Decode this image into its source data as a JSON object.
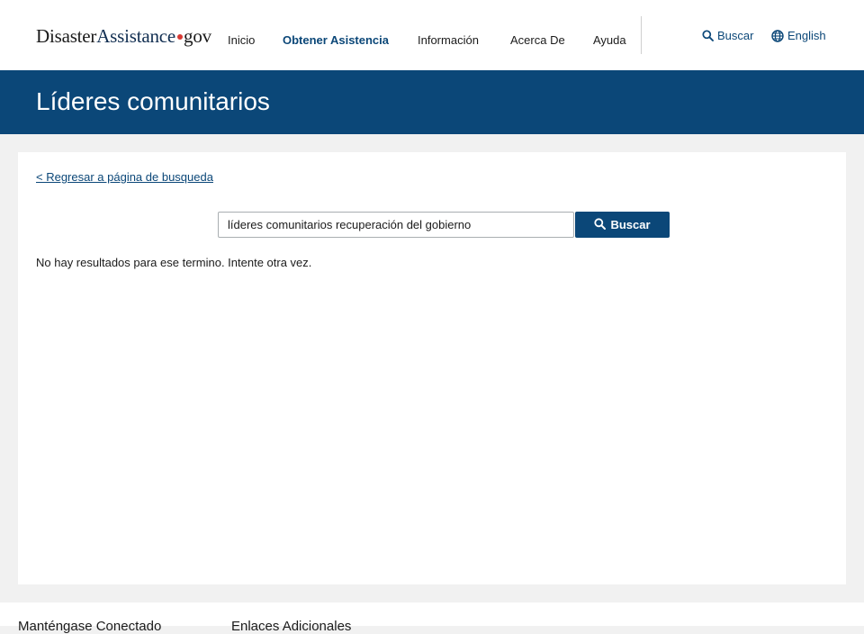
{
  "header": {
    "logo": {
      "part1": "Disaster",
      "part2": "Assistance",
      "part3": "gov"
    },
    "nav": [
      {
        "label": "Inicio",
        "active": false
      },
      {
        "label": "Obtener Asistencia",
        "active": true
      },
      {
        "label": "Información",
        "active": false
      },
      {
        "label": "Acerca De",
        "active": false
      },
      {
        "label": "Ayuda",
        "active": false
      }
    ],
    "search_link": {
      "label": "Buscar",
      "icon": "search-icon"
    },
    "language_link": {
      "label": "English",
      "icon": "globe-icon"
    }
  },
  "banner": {
    "title": "Líderes comunitarios"
  },
  "main": {
    "back_link": "< Regresar a página de busqueda",
    "search": {
      "value": "líderes comunitarios recuperación del gobierno",
      "button_label": "Buscar",
      "button_icon": "search-icon"
    },
    "message": "No hay resultados para ese termino. Intente otra vez."
  },
  "footer": {
    "headings": [
      "Manténgase Conectado",
      "Enlaces Adicionales"
    ]
  },
  "colors": {
    "brand_blue": "#0b4778",
    "logo_dot": "#d83933",
    "page_bg": "#f1f1f1"
  }
}
